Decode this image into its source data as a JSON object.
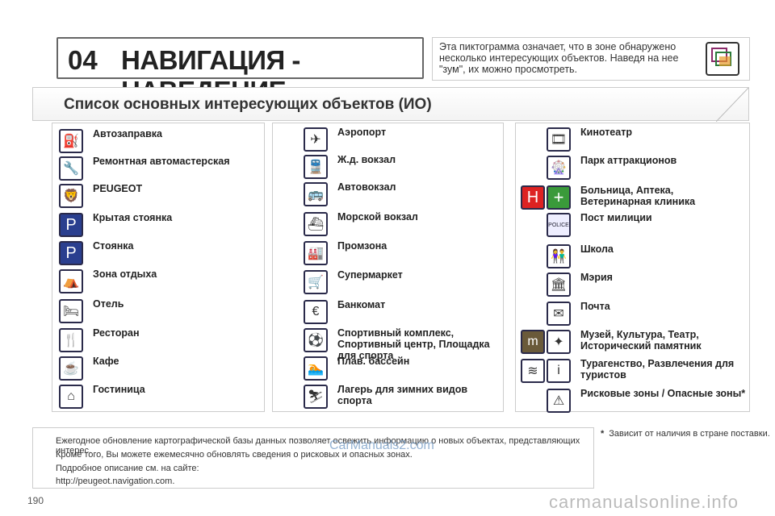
{
  "header": {
    "chapter": "04",
    "title": "НАВИГАЦИЯ - НАВЕДЕНИЕ"
  },
  "intro": {
    "text": "Эта пиктограмма означает, что в зоне обнаружено несколько интересующих объектов. Наведя на нее \"зум\", их можно просмотреть."
  },
  "section": {
    "title": "Список основных интересующих объектов (ИО)"
  },
  "col1": [
    {
      "label": "Автозаправка",
      "icon": "fuel-pump-icon",
      "glyph": "⛽"
    },
    {
      "label": "Ремонтная автомастерская",
      "icon": "wrench-icon",
      "glyph": "🔧"
    },
    {
      "label": "PEUGEOT",
      "icon": "peugeot-lion-icon",
      "glyph": "🦁"
    },
    {
      "label": "Крытая стоянка",
      "icon": "covered-parking-icon",
      "glyph": "P"
    },
    {
      "label": "Стоянка",
      "icon": "parking-icon",
      "glyph": "P"
    },
    {
      "label": "Зона отдыха",
      "icon": "rest-area-icon",
      "glyph": "⛺"
    },
    {
      "label": "Отель",
      "icon": "hotel-bed-icon",
      "glyph": "🛏"
    },
    {
      "label": "Ресторан",
      "icon": "restaurant-icon",
      "glyph": "🍴"
    },
    {
      "label": "Кафе",
      "icon": "cafe-cup-icon",
      "glyph": "☕"
    },
    {
      "label": "Гостиница",
      "icon": "inn-icon",
      "glyph": "⌂"
    }
  ],
  "col2": [
    {
      "label": "Аэропорт",
      "icon": "airplane-icon",
      "glyph": "✈"
    },
    {
      "label": "Ж.д. вокзал",
      "icon": "train-icon",
      "glyph": "🚆"
    },
    {
      "label": "Автовокзал",
      "icon": "bus-icon",
      "glyph": "🚌"
    },
    {
      "label": "Морской вокзал",
      "icon": "ship-icon",
      "glyph": "⛴"
    },
    {
      "label": "Промзона",
      "icon": "industry-icon",
      "glyph": "🏭"
    },
    {
      "label": "Супермаркет",
      "icon": "shopping-cart-icon",
      "glyph": "🛒"
    },
    {
      "label": "Банкомат",
      "icon": "atm-icon",
      "glyph": "€"
    },
    {
      "label": "Спортивный комплекс, Спортивный центр, Площадка для спорта",
      "icon": "sport-icon",
      "glyph": "⚽"
    },
    {
      "label": "Плав. бассейн",
      "icon": "swimming-icon",
      "glyph": "🏊"
    },
    {
      "label": "Лагерь для зимних видов спорта",
      "icon": "ski-icon",
      "glyph": "⛷"
    }
  ],
  "col3": [
    {
      "label": "Кинотеатр",
      "icon": "cinema-icon",
      "glyph": "🎞"
    },
    {
      "label": "Парк аттракционов",
      "icon": "ferris-wheel-icon",
      "glyph": "🎡"
    },
    {
      "label": "Больница, Аптека, Ветеринарная клиника",
      "icon": "hospital-icon",
      "glyph": "H",
      "icon2": "pharmacy-cross-icon",
      "glyph2": "+"
    },
    {
      "label": "Пост милиции",
      "icon": "police-icon",
      "glyph": "POLICE"
    },
    {
      "label": "Школа",
      "icon": "school-icon",
      "glyph": "👫"
    },
    {
      "label": "Мэрия",
      "icon": "town-hall-icon",
      "glyph": "🏛"
    },
    {
      "label": "Почта",
      "icon": "mail-icon",
      "glyph": "✉"
    },
    {
      "label": "Музей, Культура, Театр, Исторический памятник",
      "icon": "museum-icon",
      "glyph": "m",
      "icon2": "monument-icon",
      "glyph2": "✦"
    },
    {
      "label": "Турагенство, Развлечения для туристов",
      "icon": "tourism-icon",
      "glyph": "≋",
      "icon2": "info-icon",
      "glyph2": "i"
    },
    {
      "label": "Рисковые зоны / Опасные зоны*",
      "icon": "danger-zone-icon",
      "glyph": "⚠"
    }
  ],
  "footer": {
    "line1": "Ежегодное обновление картографической базы данных позволяет освежить информацию о новых объектах, представляющих интерес.",
    "line2": "Кроме того, Вы можете ежемесячно обновлять сведения о рисковых и опасных зонах.",
    "line3": "Подробное описание см. на сайте:",
    "line4": "http://peugeot.navigation.com."
  },
  "footnote": {
    "marker": "*",
    "text": "Зависит от наличия в стране поставки."
  },
  "page_number": "190",
  "watermark1": "CarManuals2.com",
  "watermark2": "carmanualsonline.info"
}
